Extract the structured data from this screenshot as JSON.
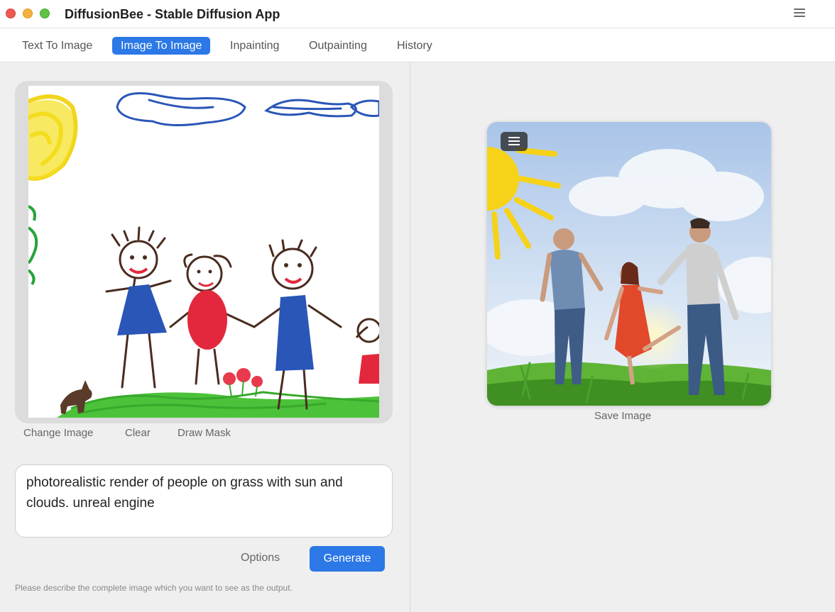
{
  "window": {
    "title": "DiffusionBee - Stable Diffusion App"
  },
  "tabs": [
    {
      "label": "Text To Image"
    },
    {
      "label": "Image To Image"
    },
    {
      "label": "Inpainting"
    },
    {
      "label": "Outpainting"
    },
    {
      "label": "History"
    }
  ],
  "active_tab": "Image To Image",
  "input_panel": {
    "actions": {
      "change_image": "Change Image",
      "clear": "Clear",
      "draw_mask": "Draw Mask"
    },
    "prompt": "photorealistic render of people on grass with sun and clouds. unreal engine",
    "options_label": "Options",
    "generate_label": "Generate",
    "hint": "Please describe the complete image which you want to see as the output."
  },
  "output_panel": {
    "save_label": "Save Image"
  },
  "icons": [
    "menu-icon",
    "output-menu-icon"
  ],
  "colors": {
    "accent": "#2b78e6",
    "traffic_red": "#ee5a52",
    "traffic_yellow": "#f4b13d",
    "traffic_green": "#5ec344"
  }
}
